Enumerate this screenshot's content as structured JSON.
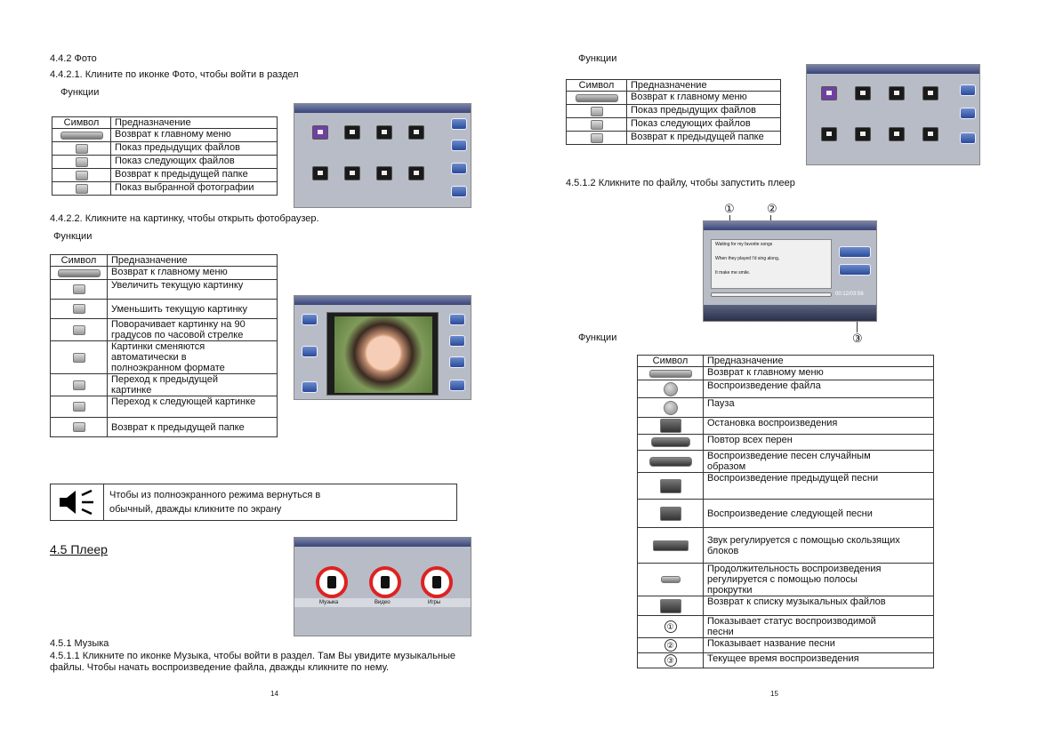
{
  "left": {
    "s442": "4.4.2 Фото",
    "s4421": "4.4.2.1. Клините по иконке Фото, чтобы войти в раздел",
    "func1": "Функции",
    "table1": {
      "hdr_sym": "Символ",
      "hdr_desc": "Предназначение",
      "rows": [
        "Возврат к главному меню",
        "Показ предыдущих файлов",
        "Показ следующих файлов",
        "Возврат к предыдущей папке",
        "Показ выбранной фотографии"
      ]
    },
    "s4422": "4.4.2.2. Кликните на картинку, чтобы открыть фотобраузер.",
    "func2": "Функции",
    "table2": {
      "hdr_sym": "Символ",
      "hdr_desc": "Предназначение",
      "r1": "Возврат к главному меню",
      "r2": "Увеличить текущую картинку",
      "r3": "Уменьшить текущую картинку",
      "r4a": "Поворачивает картинку на 90",
      "r4b": "градусов по часовой стрелке",
      "r5a": "Картинки сменяются",
      "r5b": "автоматически в",
      "r5c": "полноэкранном формате",
      "r6a": "Переход к предыдущей",
      "r6b": "картинке",
      "r7": "Переход к следующей картинке",
      "r8": "Возврат к предыдущей папке"
    },
    "note_a": "Чтобы    из    полноэкранного    режима    вернуться    в",
    "note_b": "обычный, дважды кликните по экрану",
    "s45": "4.5 Плеер",
    "player_menu": [
      "Музыка",
      "Видео",
      "Игры"
    ],
    "s451": "4.5.1 Музыка",
    "s4511a": "4.5.1.1 Кликните по иконке Музыка, чтобы войти в раздел. Там Вы увидите музыкальные",
    "s4511b": "файлы. Чтобы начать воспроизведение файла, дважды кликните по  нему.",
    "page": "14"
  },
  "right": {
    "func": "Функции",
    "table3": {
      "hdr_sym": "Символ",
      "hdr_desc": "Предназначение",
      "rows": [
        "Возврат к главному меню",
        "Показ предыдущих файлов",
        "Показ следующих файлов",
        "Возврат к предыдущей папке"
      ]
    },
    "s4512": "4.5.1.2 Кликните по файлу, чтобы запустить плеер",
    "callouts": [
      "①",
      "②",
      "③"
    ],
    "lyrics": [
      "Waiting for my favorite songs",
      "When they played I'd sing along,",
      "It make me smile."
    ],
    "time": "00:12/03:56",
    "func2": "Функции",
    "table4": {
      "hdr_sym": "Символ",
      "hdr_desc": "Предназначение",
      "r1": "Возврат к главному меню",
      "r2": "Воспроизведение файла",
      "r3": "Пауза",
      "r4": "Остановка воспроизведения",
      "r5": "Повтор всех перен",
      "r6a": "Воспроизведение песен случайным",
      "r6b": "образом",
      "r7": "Воспроизведение предыдущей песни",
      "r8": "Воспроизведение следующей песни",
      "r9a": "Звук регулируется с помощью скользящих",
      "r9b": "блоков",
      "r10a": "Продолжительность воспроизведения",
      "r10b": "регулируется с помощью  полосы",
      "r10c": "прокрутки",
      "r11": "Возврат к списку музыкальных файлов",
      "r12a": "Показывает статус воспроизводимой",
      "r12b": "песни",
      "r13": "Показывает название песни",
      "r14": "Текущее время воспроизведения"
    },
    "page": "15"
  }
}
